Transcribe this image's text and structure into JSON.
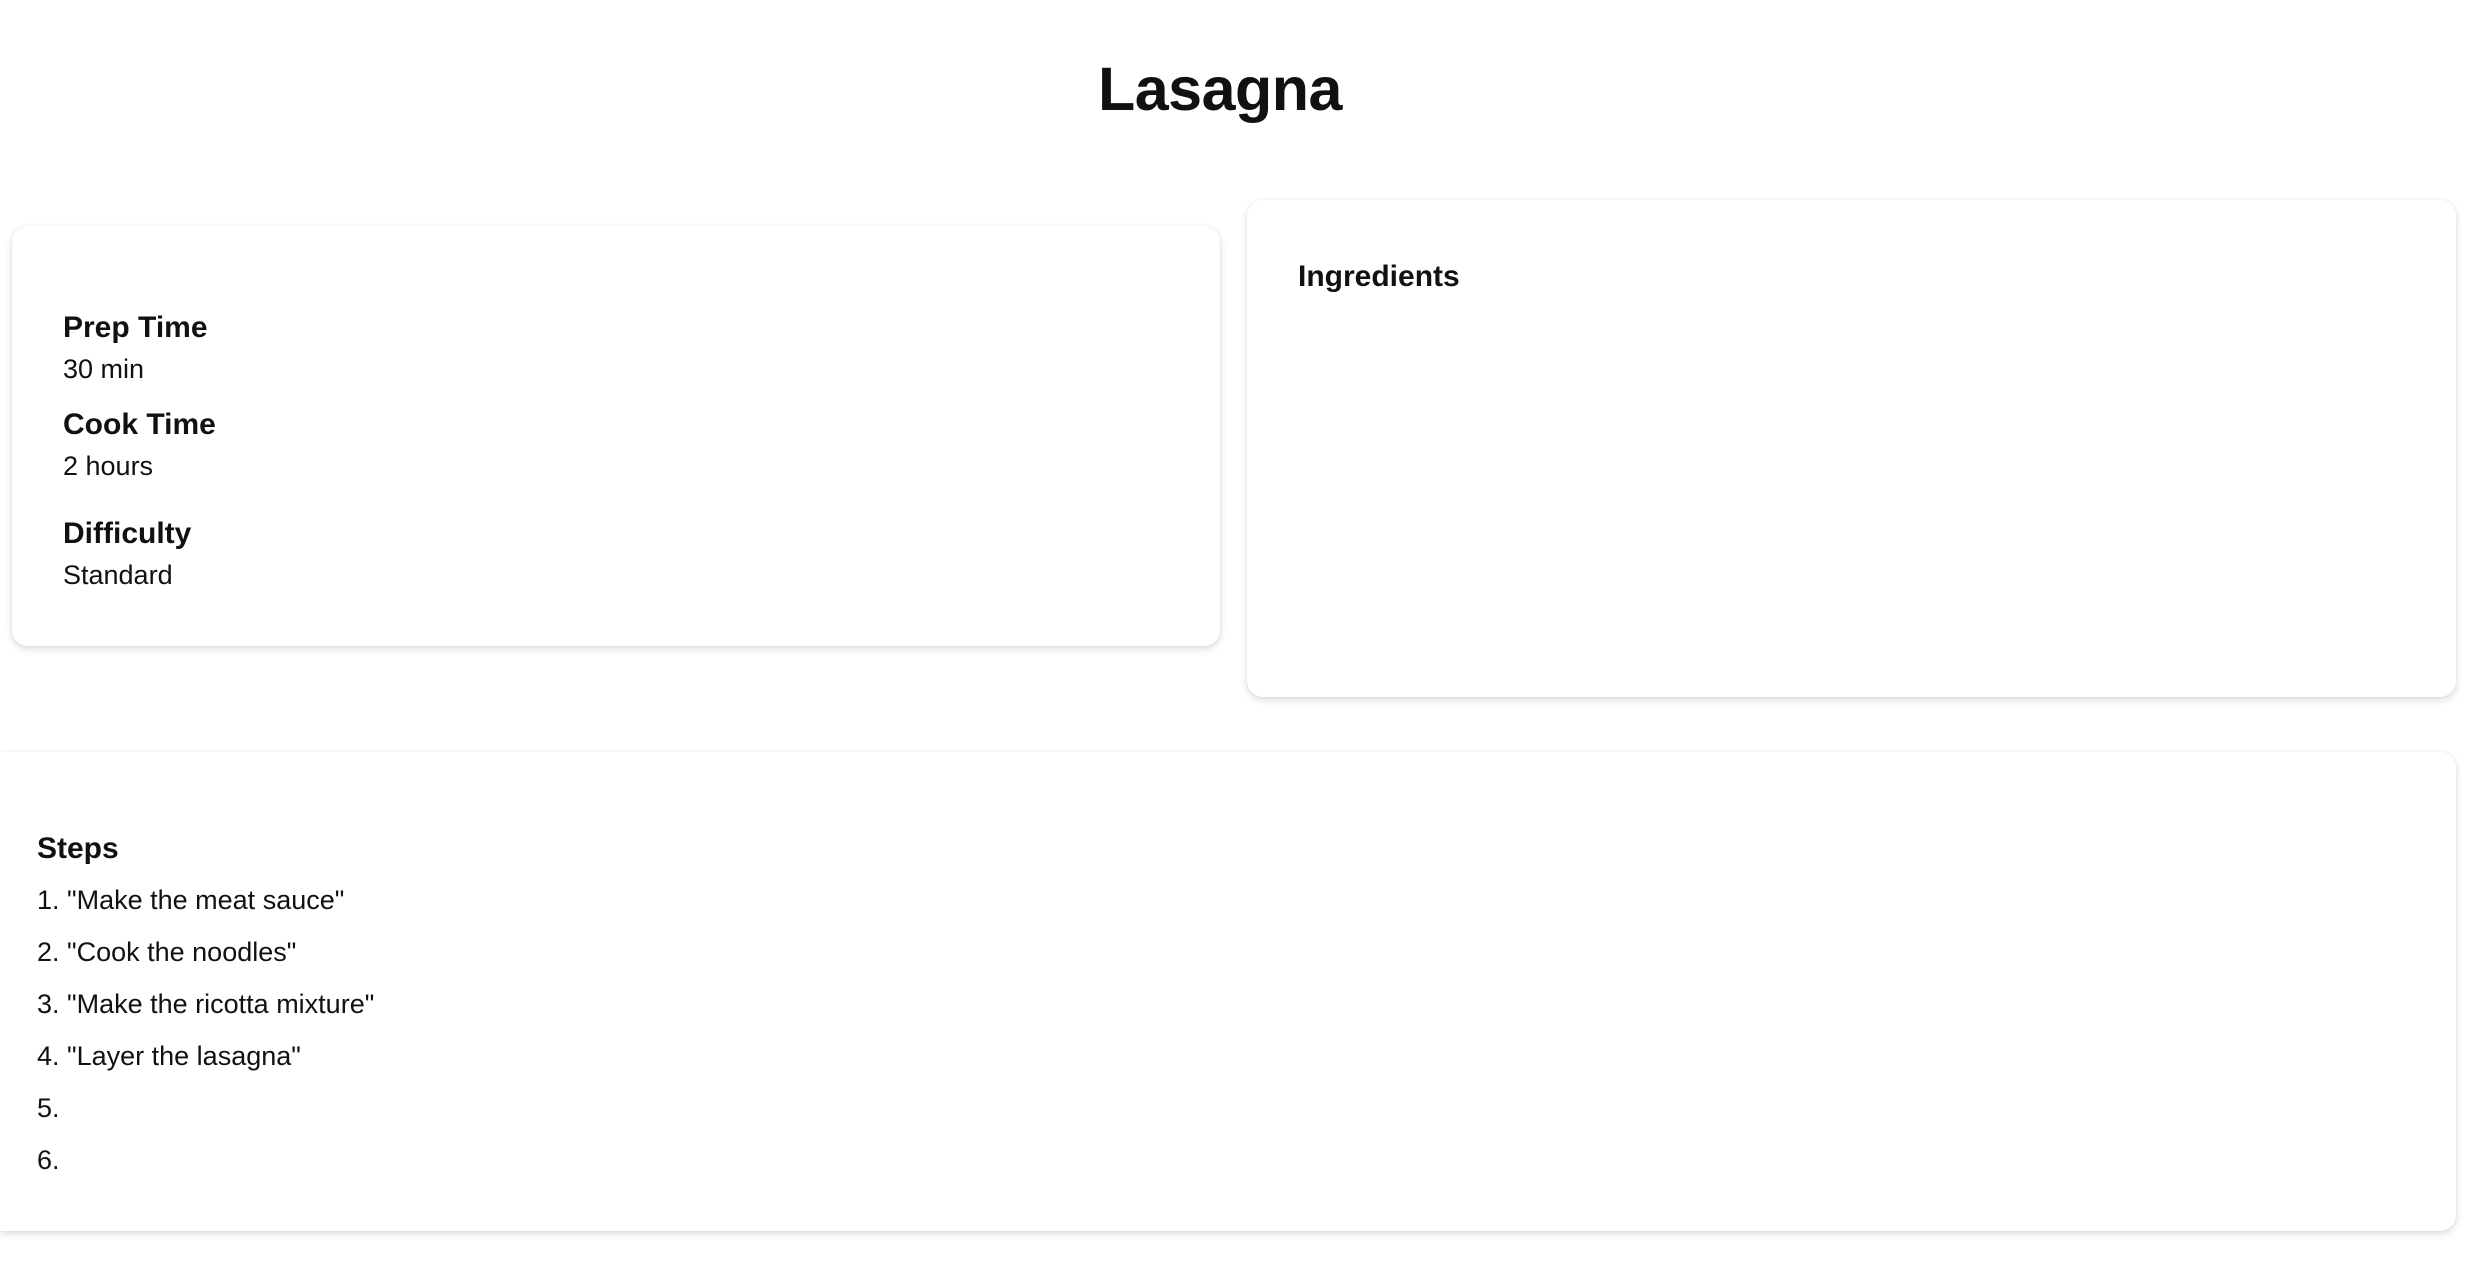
{
  "page": {
    "title": "Lasagna"
  },
  "info": {
    "prep_time_label": "Prep Time",
    "prep_time_value": "30 min",
    "cook_time_label": "Cook Time",
    "cook_time_value": "2 hours",
    "difficulty_label": "Difficulty",
    "difficulty_value": "Standard"
  },
  "ingredients": {
    "heading": "Ingredients",
    "items": []
  },
  "steps": {
    "heading": "Steps",
    "items": [
      "1. \"Make the meat sauce\"",
      "2. \"Cook the noodles\"",
      "3. \"Make the ricotta mixture\"",
      "4. \"Layer the lasagna\"",
      "5.",
      "6."
    ]
  }
}
